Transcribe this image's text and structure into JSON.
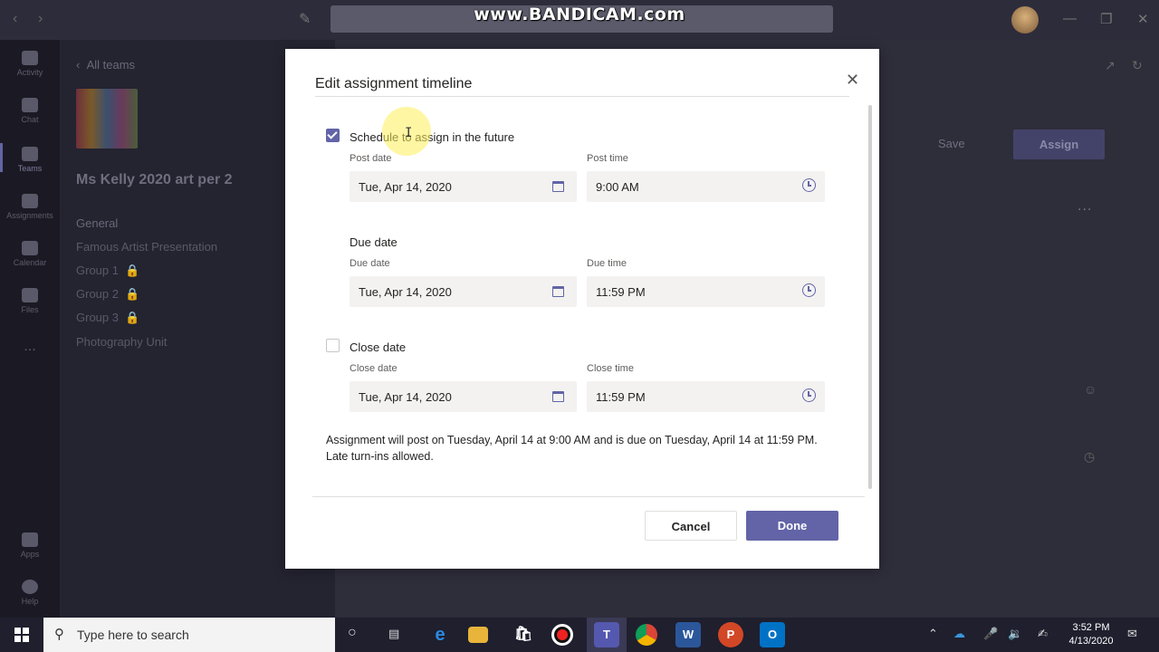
{
  "watermark": "www.BANDICAM.com",
  "team_panel": {
    "back_label": "All teams",
    "team_name": "Ms Kelly 2020 art per 2",
    "channels": [
      "General",
      "Famous Artist Presentation",
      "Group 1",
      "Group 2",
      "Group 3",
      "Photography Unit"
    ]
  },
  "rail": {
    "items": [
      {
        "label": "Activity",
        "icon": "bell-icon"
      },
      {
        "label": "Chat",
        "icon": "chat-icon"
      },
      {
        "label": "Teams",
        "icon": "teams-icon"
      },
      {
        "label": "Assignments",
        "icon": "assignments-icon"
      },
      {
        "label": "Calendar",
        "icon": "calendar-icon"
      },
      {
        "label": "Files",
        "icon": "files-icon"
      },
      {
        "label": "Apps",
        "icon": "apps-icon"
      },
      {
        "label": "Help",
        "icon": "help-icon"
      }
    ],
    "more_label": "..."
  },
  "main": {
    "save_label": "Save",
    "assign_label": "Assign",
    "more_label": "..."
  },
  "dialog": {
    "title": "Edit assignment timeline",
    "schedule_label": "Schedule to assign in the future",
    "schedule_checked": true,
    "post_date_label": "Post date",
    "post_date_value": "Tue, Apr 14, 2020",
    "post_time_label": "Post time",
    "post_time_value": "9:00 AM",
    "due_heading": "Due date",
    "due_date_label": "Due date",
    "due_date_value": "Tue, Apr 14, 2020",
    "due_time_label": "Due time",
    "due_time_value": "11:59 PM",
    "close_heading": "Close date",
    "close_checked": false,
    "close_date_label": "Close date",
    "close_date_value": "Tue, Apr 14, 2020",
    "close_time_label": "Close time",
    "close_time_value": "11:59 PM",
    "summary": "Assignment will post on Tuesday, April 14 at 9:00 AM and is due on Tuesday, April 14 at 11:59 PM. Late turn-ins allowed.",
    "cancel_label": "Cancel",
    "done_label": "Done"
  },
  "taskbar": {
    "search_placeholder": "Type here to search",
    "time": "3:52 PM",
    "date": "4/13/2020",
    "teams_label": "T"
  },
  "colors": {
    "accent": "#6264a7",
    "dialog_bg": "#ffffff",
    "overlay": "#2e2d3a"
  }
}
